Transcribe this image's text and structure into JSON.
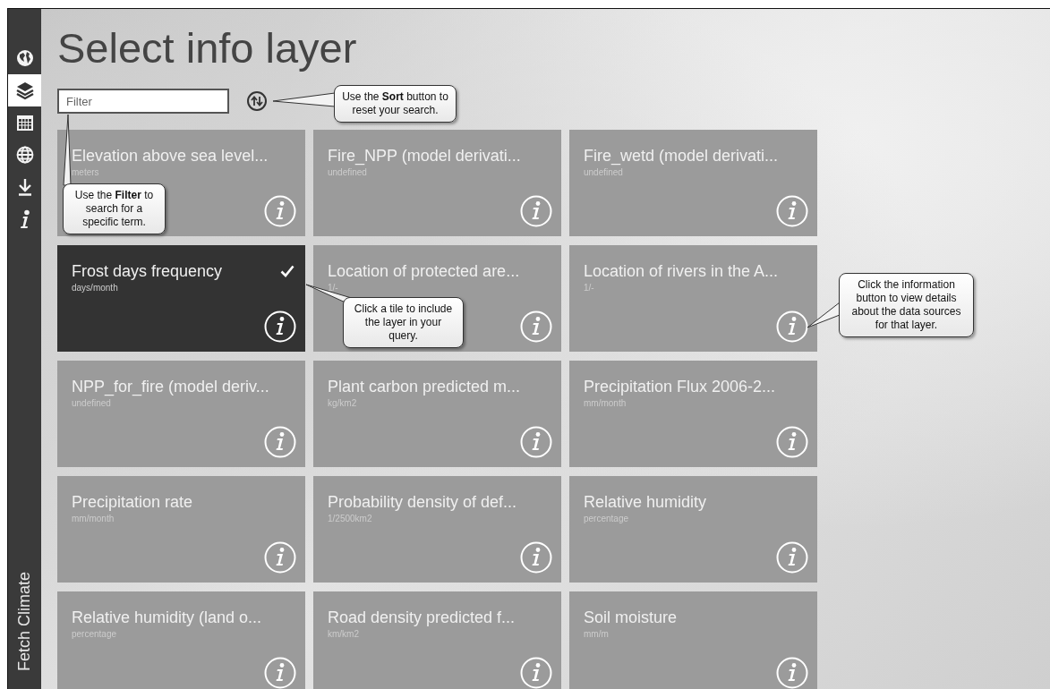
{
  "sidebar": {
    "items": [
      {
        "kind": "earth",
        "selected": false
      },
      {
        "kind": "layers",
        "selected": true
      },
      {
        "kind": "calendar",
        "selected": false
      },
      {
        "kind": "globe",
        "selected": false
      },
      {
        "kind": "download",
        "selected": false
      },
      {
        "kind": "info",
        "selected": false
      }
    ],
    "app_name": "Fetch Climate"
  },
  "title": "Select info layer",
  "filter": {
    "placeholder": "Filter"
  },
  "tiles": [
    {
      "title": "Elevation above sea level...",
      "unit": "meters",
      "selected": false
    },
    {
      "title": "Fire_NPP (model derivati...",
      "unit": "undefined",
      "selected": false
    },
    {
      "title": "Fire_wetd (model derivati...",
      "unit": "undefined",
      "selected": false
    },
    {
      "title": "Frost days frequency",
      "unit": "days/month",
      "selected": true
    },
    {
      "title": "Location of protected are...",
      "unit": "1/-",
      "selected": false
    },
    {
      "title": "Location of rivers in the A...",
      "unit": "1/-",
      "selected": false
    },
    {
      "title": "NPP_for_fire (model deriv...",
      "unit": "undefined",
      "selected": false
    },
    {
      "title": "Plant carbon predicted m...",
      "unit": "kg/km2",
      "selected": false
    },
    {
      "title": "Precipitation Flux 2006-2...",
      "unit": "mm/month",
      "selected": false
    },
    {
      "title": "Precipitation rate",
      "unit": "mm/month",
      "selected": false
    },
    {
      "title": "Probability density of def...",
      "unit": "1/2500km2",
      "selected": false
    },
    {
      "title": "Relative humidity",
      "unit": "percentage",
      "selected": false
    },
    {
      "title": "Relative humidity (land o...",
      "unit": "percentage",
      "selected": false
    },
    {
      "title": "Road density predicted f...",
      "unit": "km/km2",
      "selected": false
    },
    {
      "title": "Soil moisture",
      "unit": "mm/m",
      "selected": false
    }
  ],
  "callouts": [
    {
      "kind": "sort",
      "text": "Use the **Sort** button to reset your search."
    },
    {
      "kind": "filter",
      "text": "Use the **Filter** to search for a specific term."
    },
    {
      "kind": "tile",
      "text": "Click a tile to include the layer in your query."
    },
    {
      "kind": "info",
      "text": "Click the information button to view details about the data sources for that layer."
    }
  ]
}
